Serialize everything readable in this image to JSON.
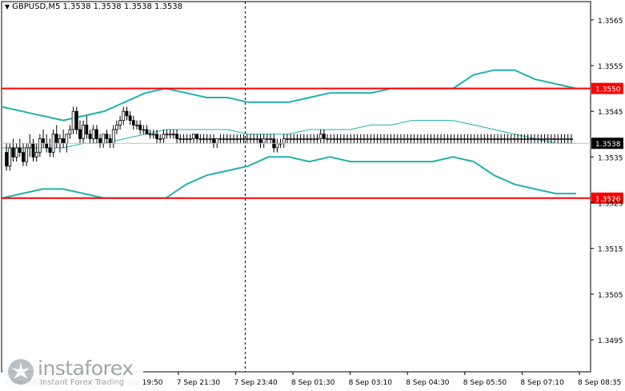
{
  "header": {
    "symbol_line": "GBPUSD,M5  1.3538 1.3538 1.3538 1.3538"
  },
  "watermark": {
    "name": "instaforex",
    "tagline": "Instant Forex Trading"
  },
  "colors": {
    "background": "#ffffff",
    "candle": "#000000",
    "band": "#20b2aa",
    "level_line": "#ff0000",
    "level_tag_bg": "#ff0000",
    "level_tag_text": "#ffffff",
    "price_tag_bg": "#000000",
    "price_tag_text": "#ffffff",
    "axis_text": "#000000"
  },
  "chart_data": {
    "type": "candlestick",
    "instrument": "GBPUSD",
    "timeframe": "M5",
    "ohlc_header": {
      "open": 1.3538,
      "high": 1.3538,
      "low": 1.3538,
      "close": 1.3538
    },
    "ylim": [
      1.3488,
      1.3569
    ],
    "y_ticks": [
      "1.3565",
      "1.3555",
      "1.3545",
      "1.3535",
      "1.3525",
      "1.3515",
      "1.3505",
      "1.3495"
    ],
    "x_labels": [
      "7 Sep 2025",
      "7 Sep 18:30",
      "7 Sep 19:50",
      "7 Sep 21:30",
      "7 Sep 23:40",
      "8 Sep 01:30",
      "8 Sep 03:10",
      "8 Sep 04:30",
      "8 Sep 05:50",
      "8 Sep 07:10",
      "8 Sep 08:35"
    ],
    "levels": [
      {
        "value": 1.355,
        "label": "1.3550"
      },
      {
        "value": 1.3526,
        "label": "1.3526"
      }
    ],
    "last_price": {
      "value": 1.3538,
      "label": "1.3538"
    },
    "separator_after_label_index": 4,
    "bollinger_bands": {
      "upper": [
        1.3546,
        1.3545,
        1.3544,
        1.3543,
        1.3544,
        1.3545,
        1.3547,
        1.3549,
        1.355,
        1.3549,
        1.3548,
        1.3548,
        1.3547,
        1.3547,
        1.3547,
        1.3548,
        1.3549,
        1.3549,
        1.3549,
        1.355,
        1.355,
        1.355,
        1.355,
        1.3553,
        1.3554,
        1.3554,
        1.3552,
        1.3551,
        1.355
      ],
      "middle": [
        1.3537,
        1.3537,
        1.3537,
        1.3537,
        1.3538,
        1.3538,
        1.3539,
        1.354,
        1.3541,
        1.3541,
        1.3541,
        1.3541,
        1.354,
        1.354,
        1.354,
        1.3541,
        1.3541,
        1.3541,
        1.3542,
        1.3542,
        1.3543,
        1.3543,
        1.3543,
        1.3542,
        1.3541,
        1.354,
        1.3539,
        1.3538,
        1.3538
      ],
      "lower": [
        1.3526,
        1.3527,
        1.3528,
        1.3528,
        1.3527,
        1.3526,
        1.3526,
        1.3526,
        1.3526,
        1.3529,
        1.3531,
        1.3532,
        1.3533,
        1.3535,
        1.3535,
        1.3534,
        1.3535,
        1.3534,
        1.3534,
        1.3534,
        1.3534,
        1.3534,
        1.3535,
        1.3534,
        1.3531,
        1.3529,
        1.3528,
        1.3527,
        1.3527
      ]
    },
    "candles": [
      {
        "o": 1.3536,
        "h": 1.3538,
        "l": 1.3532,
        "c": 1.3533
      },
      {
        "o": 1.3533,
        "h": 1.3538,
        "l": 1.3532,
        "c": 1.3537
      },
      {
        "o": 1.3537,
        "h": 1.3539,
        "l": 1.3534,
        "c": 1.3535
      },
      {
        "o": 1.3535,
        "h": 1.3538,
        "l": 1.3534,
        "c": 1.3537
      },
      {
        "o": 1.3537,
        "h": 1.3539,
        "l": 1.3535,
        "c": 1.3536
      },
      {
        "o": 1.3536,
        "h": 1.3538,
        "l": 1.3533,
        "c": 1.3534
      },
      {
        "o": 1.3534,
        "h": 1.3538,
        "l": 1.3533,
        "c": 1.3537
      },
      {
        "o": 1.3537,
        "h": 1.354,
        "l": 1.3535,
        "c": 1.3538
      },
      {
        "o": 1.3538,
        "h": 1.3539,
        "l": 1.3534,
        "c": 1.3535
      },
      {
        "o": 1.3535,
        "h": 1.3538,
        "l": 1.3534,
        "c": 1.3536
      },
      {
        "o": 1.3536,
        "h": 1.354,
        "l": 1.3535,
        "c": 1.3539
      },
      {
        "o": 1.3539,
        "h": 1.3541,
        "l": 1.3537,
        "c": 1.3538
      },
      {
        "o": 1.3538,
        "h": 1.354,
        "l": 1.3536,
        "c": 1.3537
      },
      {
        "o": 1.3537,
        "h": 1.3539,
        "l": 1.3535,
        "c": 1.3536
      },
      {
        "o": 1.3536,
        "h": 1.3541,
        "l": 1.3535,
        "c": 1.354
      },
      {
        "o": 1.354,
        "h": 1.3542,
        "l": 1.3537,
        "c": 1.3538
      },
      {
        "o": 1.3538,
        "h": 1.354,
        "l": 1.3536,
        "c": 1.3539
      },
      {
        "o": 1.3539,
        "h": 1.3541,
        "l": 1.3537,
        "c": 1.3538
      },
      {
        "o": 1.3538,
        "h": 1.354,
        "l": 1.3536,
        "c": 1.354
      },
      {
        "o": 1.354,
        "h": 1.3542,
        "l": 1.3539,
        "c": 1.3541
      },
      {
        "o": 1.3541,
        "h": 1.3546,
        "l": 1.354,
        "c": 1.3545
      },
      {
        "o": 1.3545,
        "h": 1.3546,
        "l": 1.354,
        "c": 1.3541
      },
      {
        "o": 1.3541,
        "h": 1.3543,
        "l": 1.3538,
        "c": 1.3539
      },
      {
        "o": 1.3539,
        "h": 1.3543,
        "l": 1.3538,
        "c": 1.3542
      },
      {
        "o": 1.3542,
        "h": 1.3544,
        "l": 1.3539,
        "c": 1.354
      },
      {
        "o": 1.354,
        "h": 1.3541,
        "l": 1.3538,
        "c": 1.3539
      },
      {
        "o": 1.3539,
        "h": 1.3542,
        "l": 1.3538,
        "c": 1.3541
      },
      {
        "o": 1.3541,
        "h": 1.3542,
        "l": 1.3538,
        "c": 1.3539
      },
      {
        "o": 1.3539,
        "h": 1.354,
        "l": 1.3537,
        "c": 1.3538
      },
      {
        "o": 1.3538,
        "h": 1.354,
        "l": 1.3537,
        "c": 1.354
      },
      {
        "o": 1.354,
        "h": 1.3541,
        "l": 1.3538,
        "c": 1.3539
      },
      {
        "o": 1.3539,
        "h": 1.354,
        "l": 1.3537,
        "c": 1.3538
      },
      {
        "o": 1.3538,
        "h": 1.3542,
        "l": 1.3537,
        "c": 1.3541
      },
      {
        "o": 1.3541,
        "h": 1.3543,
        "l": 1.354,
        "c": 1.3542
      },
      {
        "o": 1.3542,
        "h": 1.3544,
        "l": 1.3541,
        "c": 1.3543
      },
      {
        "o": 1.3543,
        "h": 1.3546,
        "l": 1.3542,
        "c": 1.3545
      },
      {
        "o": 1.3545,
        "h": 1.3546,
        "l": 1.3543,
        "c": 1.3544
      },
      {
        "o": 1.3544,
        "h": 1.3545,
        "l": 1.3542,
        "c": 1.3543
      },
      {
        "o": 1.3543,
        "h": 1.3544,
        "l": 1.3541,
        "c": 1.3542
      },
      {
        "o": 1.3542,
        "h": 1.3543,
        "l": 1.3541,
        "c": 1.3542
      },
      {
        "o": 1.3542,
        "h": 1.3543,
        "l": 1.354,
        "c": 1.3541
      },
      {
        "o": 1.3541,
        "h": 1.3542,
        "l": 1.354,
        "c": 1.3541
      },
      {
        "o": 1.3541,
        "h": 1.3542,
        "l": 1.354,
        "c": 1.354
      },
      {
        "o": 1.354,
        "h": 1.3541,
        "l": 1.3539,
        "c": 1.354
      },
      {
        "o": 1.354,
        "h": 1.3541,
        "l": 1.3539,
        "c": 1.354
      },
      {
        "o": 1.354,
        "h": 1.3541,
        "l": 1.3538,
        "c": 1.3539
      },
      {
        "o": 1.3539,
        "h": 1.354,
        "l": 1.3538,
        "c": 1.3539
      },
      {
        "o": 1.3539,
        "h": 1.3541,
        "l": 1.3538,
        "c": 1.354
      },
      {
        "o": 1.354,
        "h": 1.3541,
        "l": 1.3539,
        "c": 1.354
      },
      {
        "o": 1.354,
        "h": 1.3541,
        "l": 1.3539,
        "c": 1.354
      },
      {
        "o": 1.354,
        "h": 1.3541,
        "l": 1.3539,
        "c": 1.354
      },
      {
        "o": 1.354,
        "h": 1.3541,
        "l": 1.3538,
        "c": 1.3539
      },
      {
        "o": 1.3539,
        "h": 1.354,
        "l": 1.3538,
        "c": 1.3539
      },
      {
        "o": 1.3539,
        "h": 1.354,
        "l": 1.3538,
        "c": 1.3539
      },
      {
        "o": 1.3539,
        "h": 1.354,
        "l": 1.3538,
        "c": 1.3539
      },
      {
        "o": 1.3539,
        "h": 1.354,
        "l": 1.3538,
        "c": 1.3539
      },
      {
        "o": 1.3539,
        "h": 1.354,
        "l": 1.3538,
        "c": 1.354
      },
      {
        "o": 1.354,
        "h": 1.354,
        "l": 1.3538,
        "c": 1.3539
      },
      {
        "o": 1.3539,
        "h": 1.354,
        "l": 1.3538,
        "c": 1.3539
      },
      {
        "o": 1.3539,
        "h": 1.354,
        "l": 1.3538,
        "c": 1.3539
      },
      {
        "o": 1.3539,
        "h": 1.354,
        "l": 1.3538,
        "c": 1.3539
      },
      {
        "o": 1.3539,
        "h": 1.354,
        "l": 1.3538,
        "c": 1.3539
      },
      {
        "o": 1.3539,
        "h": 1.354,
        "l": 1.3537,
        "c": 1.3538
      },
      {
        "o": 1.3538,
        "h": 1.3539,
        "l": 1.3537,
        "c": 1.3539
      },
      {
        "o": 1.3539,
        "h": 1.354,
        "l": 1.3538,
        "c": 1.3539
      },
      {
        "o": 1.3539,
        "h": 1.354,
        "l": 1.3538,
        "c": 1.3539
      },
      {
        "o": 1.3539,
        "h": 1.354,
        "l": 1.3538,
        "c": 1.3539
      },
      {
        "o": 1.3539,
        "h": 1.354,
        "l": 1.3538,
        "c": 1.3539
      },
      {
        "o": 1.3539,
        "h": 1.354,
        "l": 1.3538,
        "c": 1.3539
      },
      {
        "o": 1.3539,
        "h": 1.354,
        "l": 1.3538,
        "c": 1.3539
      },
      {
        "o": 1.3539,
        "h": 1.354,
        "l": 1.3538,
        "c": 1.3539
      },
      {
        "o": 1.3539,
        "h": 1.354,
        "l": 1.3538,
        "c": 1.3539
      },
      {
        "o": 1.3539,
        "h": 1.354,
        "l": 1.3538,
        "c": 1.3539
      },
      {
        "o": 1.3539,
        "h": 1.354,
        "l": 1.3538,
        "c": 1.3539
      },
      {
        "o": 1.3539,
        "h": 1.354,
        "l": 1.3538,
        "c": 1.3539
      },
      {
        "o": 1.3539,
        "h": 1.354,
        "l": 1.3538,
        "c": 1.3539
      },
      {
        "o": 1.3539,
        "h": 1.354,
        "l": 1.3537,
        "c": 1.3538
      },
      {
        "o": 1.3538,
        "h": 1.354,
        "l": 1.3537,
        "c": 1.3539
      },
      {
        "o": 1.3539,
        "h": 1.354,
        "l": 1.3538,
        "c": 1.3539
      },
      {
        "o": 1.3539,
        "h": 1.354,
        "l": 1.3538,
        "c": 1.3539
      },
      {
        "o": 1.3539,
        "h": 1.354,
        "l": 1.3536,
        "c": 1.3537
      },
      {
        "o": 1.3537,
        "h": 1.3539,
        "l": 1.3536,
        "c": 1.3538
      },
      {
        "o": 1.3538,
        "h": 1.3539,
        "l": 1.3537,
        "c": 1.3538
      },
      {
        "o": 1.3538,
        "h": 1.354,
        "l": 1.3537,
        "c": 1.3539
      },
      {
        "o": 1.3539,
        "h": 1.354,
        "l": 1.3538,
        "c": 1.3539
      },
      {
        "o": 1.3539,
        "h": 1.354,
        "l": 1.3538,
        "c": 1.3539
      },
      {
        "o": 1.3539,
        "h": 1.354,
        "l": 1.3538,
        "c": 1.3539
      },
      {
        "o": 1.3539,
        "h": 1.354,
        "l": 1.3538,
        "c": 1.3539
      },
      {
        "o": 1.3539,
        "h": 1.354,
        "l": 1.3538,
        "c": 1.3539
      },
      {
        "o": 1.3539,
        "h": 1.354,
        "l": 1.3538,
        "c": 1.3539
      },
      {
        "o": 1.3539,
        "h": 1.354,
        "l": 1.3538,
        "c": 1.3539
      },
      {
        "o": 1.3539,
        "h": 1.354,
        "l": 1.3538,
        "c": 1.3539
      },
      {
        "o": 1.3539,
        "h": 1.354,
        "l": 1.3538,
        "c": 1.3539
      },
      {
        "o": 1.3539,
        "h": 1.354,
        "l": 1.3538,
        "c": 1.3539
      },
      {
        "o": 1.3539,
        "h": 1.3541,
        "l": 1.3538,
        "c": 1.354
      },
      {
        "o": 1.354,
        "h": 1.3541,
        "l": 1.3538,
        "c": 1.3539
      },
      {
        "o": 1.3539,
        "h": 1.354,
        "l": 1.3538,
        "c": 1.3539
      },
      {
        "o": 1.3539,
        "h": 1.354,
        "l": 1.3538,
        "c": 1.3539
      },
      {
        "o": 1.3539,
        "h": 1.354,
        "l": 1.3538,
        "c": 1.3539
      },
      {
        "o": 1.3539,
        "h": 1.354,
        "l": 1.3538,
        "c": 1.3539
      },
      {
        "o": 1.3539,
        "h": 1.354,
        "l": 1.3538,
        "c": 1.3539
      },
      {
        "o": 1.3539,
        "h": 1.354,
        "l": 1.3538,
        "c": 1.3539
      },
      {
        "o": 1.3539,
        "h": 1.354,
        "l": 1.3538,
        "c": 1.3539
      },
      {
        "o": 1.3539,
        "h": 1.354,
        "l": 1.3538,
        "c": 1.3539
      },
      {
        "o": 1.3539,
        "h": 1.354,
        "l": 1.3538,
        "c": 1.3539
      },
      {
        "o": 1.3539,
        "h": 1.354,
        "l": 1.3538,
        "c": 1.3539
      },
      {
        "o": 1.3539,
        "h": 1.354,
        "l": 1.3538,
        "c": 1.3539
      },
      {
        "o": 1.3539,
        "h": 1.354,
        "l": 1.3538,
        "c": 1.3539
      },
      {
        "o": 1.3539,
        "h": 1.354,
        "l": 1.3538,
        "c": 1.3539
      },
      {
        "o": 1.3539,
        "h": 1.354,
        "l": 1.3538,
        "c": 1.3539
      },
      {
        "o": 1.3539,
        "h": 1.354,
        "l": 1.3538,
        "c": 1.3539
      },
      {
        "o": 1.3539,
        "h": 1.354,
        "l": 1.3538,
        "c": 1.3539
      },
      {
        "o": 1.3539,
        "h": 1.354,
        "l": 1.3538,
        "c": 1.3539
      },
      {
        "o": 1.3539,
        "h": 1.354,
        "l": 1.3538,
        "c": 1.3539
      },
      {
        "o": 1.3539,
        "h": 1.354,
        "l": 1.3538,
        "c": 1.3539
      },
      {
        "o": 1.3539,
        "h": 1.354,
        "l": 1.3538,
        "c": 1.3539
      },
      {
        "o": 1.3539,
        "h": 1.354,
        "l": 1.3538,
        "c": 1.3539
      },
      {
        "o": 1.3539,
        "h": 1.354,
        "l": 1.3538,
        "c": 1.3539
      },
      {
        "o": 1.3539,
        "h": 1.354,
        "l": 1.3538,
        "c": 1.3539
      },
      {
        "o": 1.3539,
        "h": 1.354,
        "l": 1.3538,
        "c": 1.3539
      },
      {
        "o": 1.3539,
        "h": 1.354,
        "l": 1.3538,
        "c": 1.3539
      },
      {
        "o": 1.3539,
        "h": 1.354,
        "l": 1.3538,
        "c": 1.3539
      },
      {
        "o": 1.3539,
        "h": 1.354,
        "l": 1.3538,
        "c": 1.3539
      },
      {
        "o": 1.3539,
        "h": 1.354,
        "l": 1.3538,
        "c": 1.3539
      },
      {
        "o": 1.3539,
        "h": 1.354,
        "l": 1.3538,
        "c": 1.3539
      },
      {
        "o": 1.3539,
        "h": 1.354,
        "l": 1.3538,
        "c": 1.3539
      },
      {
        "o": 1.3539,
        "h": 1.354,
        "l": 1.3538,
        "c": 1.3539
      },
      {
        "o": 1.3539,
        "h": 1.354,
        "l": 1.3538,
        "c": 1.3539
      },
      {
        "o": 1.3539,
        "h": 1.354,
        "l": 1.3538,
        "c": 1.3539
      },
      {
        "o": 1.3539,
        "h": 1.354,
        "l": 1.3538,
        "c": 1.3539
      },
      {
        "o": 1.3539,
        "h": 1.354,
        "l": 1.3538,
        "c": 1.3539
      },
      {
        "o": 1.3539,
        "h": 1.354,
        "l": 1.3538,
        "c": 1.3539
      },
      {
        "o": 1.3539,
        "h": 1.354,
        "l": 1.3538,
        "c": 1.3539
      },
      {
        "o": 1.3539,
        "h": 1.354,
        "l": 1.3538,
        "c": 1.3539
      },
      {
        "o": 1.3539,
        "h": 1.354,
        "l": 1.3538,
        "c": 1.3539
      },
      {
        "o": 1.3539,
        "h": 1.354,
        "l": 1.3538,
        "c": 1.3539
      },
      {
        "o": 1.3539,
        "h": 1.354,
        "l": 1.3538,
        "c": 1.3539
      },
      {
        "o": 1.3539,
        "h": 1.354,
        "l": 1.3538,
        "c": 1.3539
      },
      {
        "o": 1.3539,
        "h": 1.354,
        "l": 1.3538,
        "c": 1.3539
      },
      {
        "o": 1.3539,
        "h": 1.354,
        "l": 1.3538,
        "c": 1.3539
      },
      {
        "o": 1.3539,
        "h": 1.354,
        "l": 1.3538,
        "c": 1.3539
      },
      {
        "o": 1.3539,
        "h": 1.354,
        "l": 1.3538,
        "c": 1.3539
      },
      {
        "o": 1.3539,
        "h": 1.354,
        "l": 1.3538,
        "c": 1.3539
      },
      {
        "o": 1.3539,
        "h": 1.354,
        "l": 1.3538,
        "c": 1.3539
      },
      {
        "o": 1.3539,
        "h": 1.354,
        "l": 1.3538,
        "c": 1.3539
      },
      {
        "o": 1.3539,
        "h": 1.354,
        "l": 1.3538,
        "c": 1.3539
      },
      {
        "o": 1.3539,
        "h": 1.354,
        "l": 1.3538,
        "c": 1.3539
      },
      {
        "o": 1.3539,
        "h": 1.354,
        "l": 1.3538,
        "c": 1.3539
      },
      {
        "o": 1.3539,
        "h": 1.354,
        "l": 1.3538,
        "c": 1.3539
      },
      {
        "o": 1.3539,
        "h": 1.354,
        "l": 1.3538,
        "c": 1.3539
      },
      {
        "o": 1.3539,
        "h": 1.354,
        "l": 1.3538,
        "c": 1.3539
      },
      {
        "o": 1.3539,
        "h": 1.354,
        "l": 1.3538,
        "c": 1.3539
      },
      {
        "o": 1.3539,
        "h": 1.354,
        "l": 1.3538,
        "c": 1.3539
      },
      {
        "o": 1.3539,
        "h": 1.354,
        "l": 1.3538,
        "c": 1.3539
      },
      {
        "o": 1.3539,
        "h": 1.354,
        "l": 1.3538,
        "c": 1.3539
      },
      {
        "o": 1.3539,
        "h": 1.354,
        "l": 1.3538,
        "c": 1.3539
      },
      {
        "o": 1.3539,
        "h": 1.354,
        "l": 1.3538,
        "c": 1.3539
      },
      {
        "o": 1.3539,
        "h": 1.354,
        "l": 1.3538,
        "c": 1.3539
      },
      {
        "o": 1.3539,
        "h": 1.354,
        "l": 1.3538,
        "c": 1.3539
      },
      {
        "o": 1.3539,
        "h": 1.354,
        "l": 1.3538,
        "c": 1.3539
      },
      {
        "o": 1.3539,
        "h": 1.354,
        "l": 1.3538,
        "c": 1.3539
      },
      {
        "o": 1.3539,
        "h": 1.354,
        "l": 1.3538,
        "c": 1.3539
      },
      {
        "o": 1.3539,
        "h": 1.354,
        "l": 1.3538,
        "c": 1.3539
      },
      {
        "o": 1.3539,
        "h": 1.354,
        "l": 1.3538,
        "c": 1.3539
      },
      {
        "o": 1.3539,
        "h": 1.354,
        "l": 1.3538,
        "c": 1.3539
      },
      {
        "o": 1.3539,
        "h": 1.354,
        "l": 1.3538,
        "c": 1.3539
      },
      {
        "o": 1.3539,
        "h": 1.354,
        "l": 1.3538,
        "c": 1.3539
      },
      {
        "o": 1.3539,
        "h": 1.354,
        "l": 1.3538,
        "c": 1.3539
      },
      {
        "o": 1.3539,
        "h": 1.354,
        "l": 1.3538,
        "c": 1.3539
      },
      {
        "o": 1.3539,
        "h": 1.354,
        "l": 1.3538,
        "c": 1.3539
      }
    ]
  }
}
